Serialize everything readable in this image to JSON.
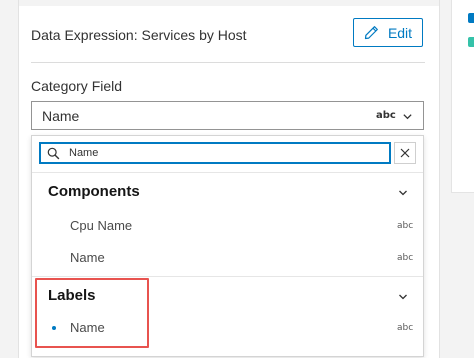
{
  "header": {
    "data_expression_title": "Data Expression: Services by Host",
    "edit_label": "Edit"
  },
  "category_field": {
    "label": "Category Field",
    "selected_value": "Name",
    "selected_type": "abc"
  },
  "search": {
    "value": "Name",
    "placeholder": ""
  },
  "groups": [
    {
      "title": "Components",
      "options": [
        {
          "label": "Cpu Name",
          "type": "abc"
        },
        {
          "label": "Name",
          "type": "abc"
        }
      ]
    },
    {
      "title": "Labels",
      "options": [
        {
          "label": "Name",
          "type": "abc",
          "selected": true
        }
      ]
    }
  ],
  "colors": {
    "accent": "#007ac2",
    "legend_swatch_1": "#007ac2",
    "legend_swatch_2": "#35c2a9",
    "highlight_annotation": "#e8534f"
  },
  "icons": {
    "edit": "pencil-icon",
    "select": "chevron-down-icon",
    "search": "search-icon",
    "clear": "close-icon",
    "group_toggle": "chevron-down-icon",
    "selected_marker": "bullet-dot-icon"
  }
}
